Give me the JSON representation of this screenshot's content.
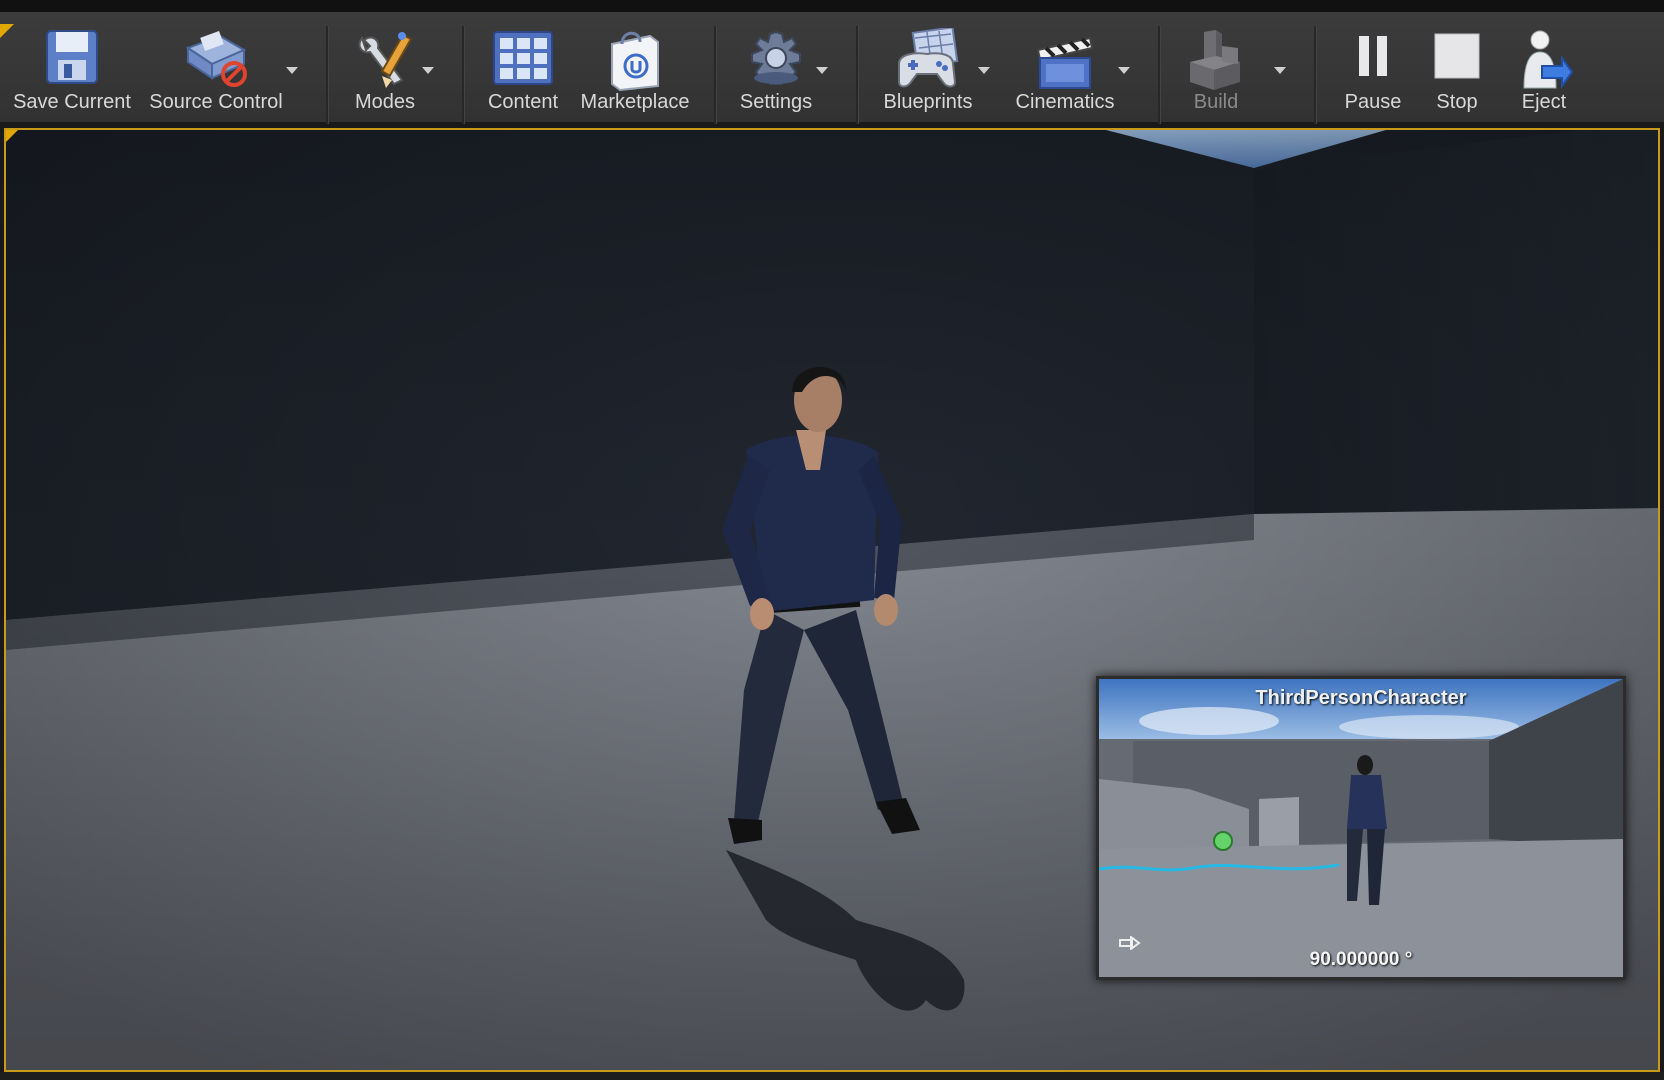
{
  "toolbar": {
    "items": [
      {
        "label": "Save Current",
        "icon": "floppy-disk-icon"
      },
      {
        "label": "Source Control",
        "icon": "source-control-icon"
      },
      {
        "label": "Modes",
        "icon": "wrench-pencil-icon"
      },
      {
        "label": "Content",
        "icon": "content-grid-icon"
      },
      {
        "label": "Marketplace",
        "icon": "marketplace-bag-icon"
      },
      {
        "label": "Settings",
        "icon": "gear-icon"
      },
      {
        "label": "Blueprints",
        "icon": "gamepad-icon"
      },
      {
        "label": "Cinematics",
        "icon": "clapperboard-icon"
      },
      {
        "label": "Build",
        "icon": "build-blocks-icon",
        "disabled": true
      },
      {
        "label": "Pause",
        "icon": "pause-icon"
      },
      {
        "label": "Stop",
        "icon": "stop-icon"
      },
      {
        "label": "Eject",
        "icon": "eject-person-icon"
      }
    ]
  },
  "viewport": {
    "scene": "third-person-arena",
    "accent_color": "#c99a1a"
  },
  "pip": {
    "title": "ThirdPersonCharacter",
    "angle": "90.000000 °"
  },
  "colors": {
    "toolbar_bg": "#363636",
    "label_text": "#d8d8d8",
    "disabled_text": "#8a8a8a",
    "floor": "#7f838c",
    "wall": "#1c212a",
    "sky": "#8cb8e8"
  }
}
